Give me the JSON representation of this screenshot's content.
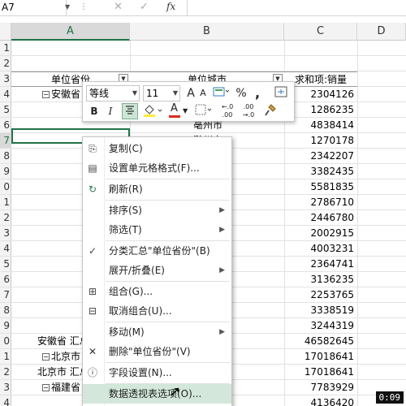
{
  "formula_bar": {
    "name_box": "A7",
    "cancel_icon": "✕",
    "enter_icon": "✓",
    "fx_label": "fx",
    "formula": ""
  },
  "columns": [
    {
      "label": "A",
      "selected": true
    },
    {
      "label": "B",
      "selected": false
    },
    {
      "label": "C",
      "selected": false
    },
    {
      "label": "D",
      "selected": false
    }
  ],
  "rows": [
    "1",
    "2",
    "3",
    "4",
    "5",
    "6",
    "7",
    "8",
    "9",
    "0",
    "1",
    "2",
    "3",
    "4",
    "5",
    "6",
    "7",
    "8",
    "9",
    "0",
    "1",
    "2",
    "3",
    "4"
  ],
  "pivot": {
    "header": {
      "province": "单位省份",
      "city": "单位城市",
      "sum": "求和项:销量"
    },
    "rows": [
      {
        "a": "安徽省",
        "b": "",
        "c": "2304126",
        "a_collapse": true
      },
      {
        "a": "",
        "b": "",
        "c": "1286235"
      },
      {
        "a": "",
        "b": "亳州市",
        "c": "4838414"
      },
      {
        "a": "",
        "b": "滁州市",
        "c": "1270178"
      },
      {
        "a": "",
        "b": "",
        "c": "2342207"
      },
      {
        "a": "",
        "b": "",
        "c": "3382435"
      },
      {
        "a": "",
        "b": "",
        "c": "5581835"
      },
      {
        "a": "",
        "b": "",
        "c": "2786710"
      },
      {
        "a": "",
        "b": "",
        "c": "2446780"
      },
      {
        "a": "",
        "b": "",
        "c": "2002915"
      },
      {
        "a": "",
        "b": "",
        "c": "4003231"
      },
      {
        "a": "",
        "b": "",
        "c": "2364741"
      },
      {
        "a": "",
        "b": "",
        "c": "3136235"
      },
      {
        "a": "",
        "b": "",
        "c": "2253765"
      },
      {
        "a": "",
        "b": "",
        "c": "3338519"
      },
      {
        "a": "",
        "b": "",
        "c": "3244319"
      },
      {
        "a": "安徽省 汇总",
        "b": "",
        "c": "46582645"
      },
      {
        "a": "北京市",
        "b": "",
        "c": "17018641",
        "a_collapse": true
      },
      {
        "a": "北京市 汇总",
        "b": "",
        "c": "17018641"
      },
      {
        "a": "福建省",
        "b": "",
        "c": "7783929",
        "a_collapse": true
      },
      {
        "a": "",
        "b": "",
        "c": "4136420"
      }
    ]
  },
  "mini_toolbar": {
    "font_name": "等线",
    "font_size": "11",
    "grow_font": "A",
    "shrink_font": "A",
    "number_format_icon": "number-format-icon",
    "percent": "%",
    "comma": ",",
    "bold": "B",
    "italic": "I",
    "align_center_icon": "center-align-icon",
    "fill_color": "#ffeb3b",
    "font_color": "#d62d20",
    "font_color_letter": "A",
    "increase_decimal": "←.0 .00",
    "decrease_decimal": ".00 →.0",
    "format_painter_icon": "format-painter-icon"
  },
  "context_menu": {
    "items": [
      {
        "label": "复制(C)",
        "icon": "copy-icon",
        "glyph": "⎘"
      },
      {
        "label": "设置单元格格式(F)...",
        "icon": "format-cells-icon",
        "glyph": "▤"
      },
      {
        "label": "刷新(R)",
        "icon": "refresh-icon",
        "glyph": "↻"
      },
      {
        "label": "排序(S)",
        "icon": "",
        "glyph": "",
        "submenu": true
      },
      {
        "label": "筛选(T)",
        "icon": "",
        "glyph": "",
        "submenu": true
      },
      {
        "label": "分类汇总\"单位省份\"(B)",
        "icon": "check-icon",
        "glyph": "✓"
      },
      {
        "label": "展开/折叠(E)",
        "icon": "",
        "glyph": "",
        "submenu": true
      },
      {
        "label": "组合(G)...",
        "icon": "group-icon",
        "glyph": "⊞"
      },
      {
        "label": "取消组合(U)...",
        "icon": "ungroup-icon",
        "glyph": "⊟"
      },
      {
        "label": "移动(M)",
        "icon": "",
        "glyph": "",
        "submenu": true
      },
      {
        "label": "删除\"单位省份\"(V)",
        "icon": "delete-icon",
        "glyph": "✕"
      },
      {
        "label": "字段设置(N)...",
        "icon": "field-settings-icon",
        "glyph": "ⓘ"
      },
      {
        "label": "数据透视表选项(O)...",
        "icon": "",
        "glyph": "",
        "highlighted": true
      }
    ]
  },
  "timer": "0:09",
  "colors": {
    "accent": "#217346",
    "menu_highlight": "#d3e7da"
  }
}
